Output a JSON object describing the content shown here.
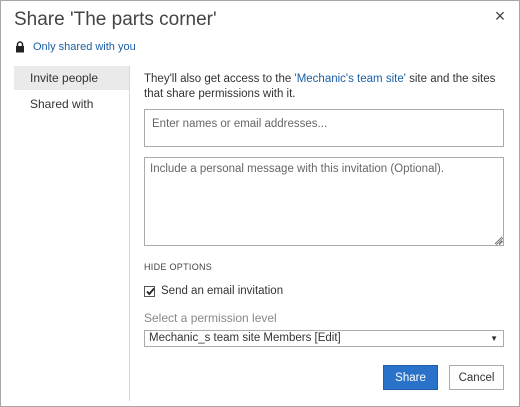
{
  "dialog": {
    "title": "Share 'The parts corner'",
    "close_icon": "close-icon",
    "close_glyph": "×"
  },
  "sharing_status": {
    "icon": "lock-icon",
    "link_text": "Only shared with you"
  },
  "sidebar": {
    "items": [
      {
        "label": "Invite people",
        "active": true
      },
      {
        "label": "Shared with",
        "active": false
      }
    ]
  },
  "invite": {
    "info_prefix": "They'll also get access to the ",
    "info_site": "'Mechanic's team site'",
    "info_suffix": " site and the sites that share permissions with it.",
    "names_placeholder": "Enter names or email addresses...",
    "names_value": "",
    "message_placeholder": "Include a personal message with this invitation (Optional).",
    "message_value": "",
    "hide_options_label": "HIDE OPTIONS",
    "send_email_label": "Send an email invitation",
    "send_email_checked": true,
    "permission_label": "Select a permission level",
    "permission_selected": "Mechanic_s team site Members [Edit]",
    "dropdown_arrow": "▼"
  },
  "buttons": {
    "share_label": "Share",
    "cancel_label": "Cancel"
  },
  "colors": {
    "accent": "#2a72c9",
    "link": "#1a5fa8",
    "sidebar_active": "#eaeaea"
  }
}
